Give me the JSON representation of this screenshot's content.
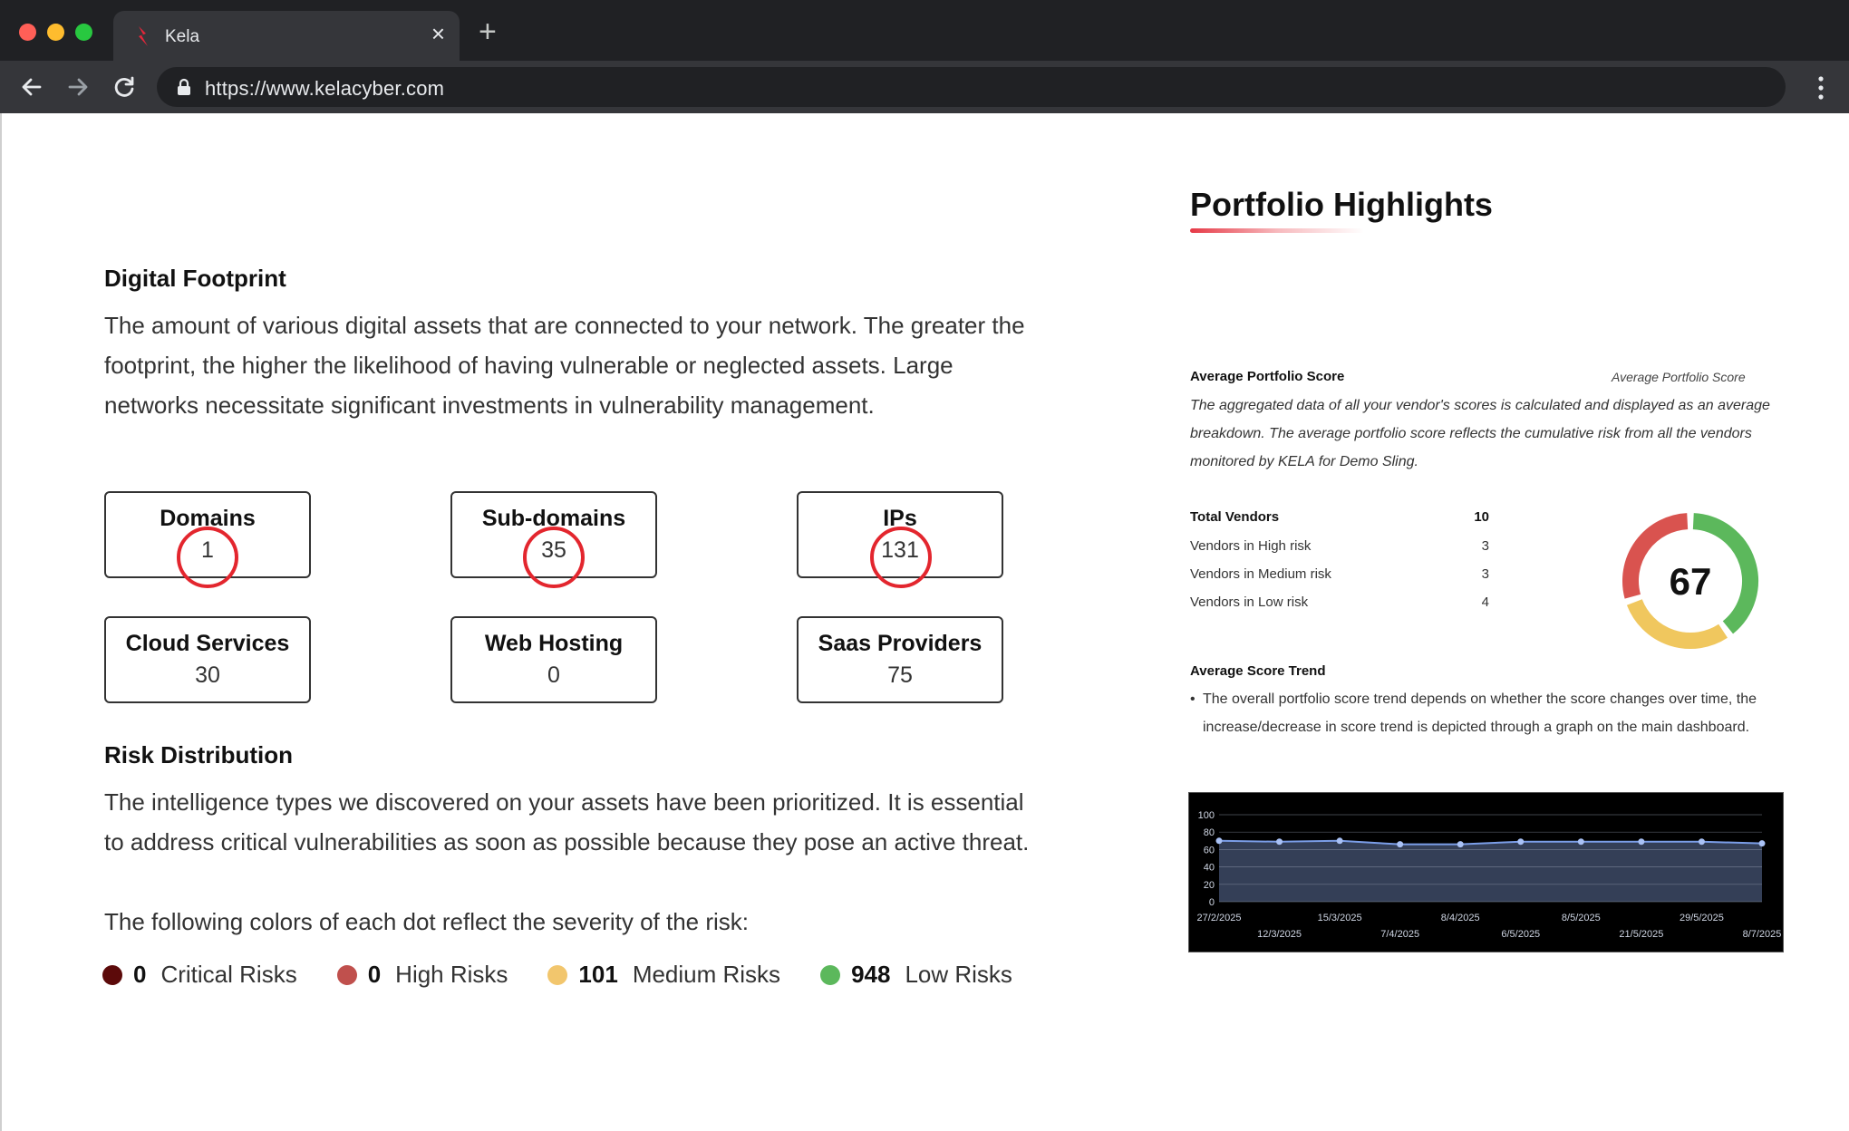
{
  "browser": {
    "tab_title": "Kela",
    "url": "https://www.kelacyber.com",
    "close_glyph": "×",
    "new_tab_glyph": "+"
  },
  "digital_footprint": {
    "heading": "Digital Footprint",
    "description": "The amount of various digital assets that are connected to your network. The greater the footprint, the higher the likelihood of having vulnerable or neglected assets. Large networks necessitate significant investments in vulnerability management.",
    "assets": [
      {
        "label": "Domains",
        "value": "1",
        "circled": true
      },
      {
        "label": "Sub-domains",
        "value": "35",
        "circled": true
      },
      {
        "label": "IPs",
        "value": "131",
        "circled": true
      },
      {
        "label": "Cloud Services",
        "value": "30",
        "circled": false
      },
      {
        "label": "Web Hosting",
        "value": "0",
        "circled": false
      },
      {
        "label": "Saas Providers",
        "value": "75",
        "circled": false
      }
    ]
  },
  "risk_distribution": {
    "heading": "Risk Distribution",
    "description": "The intelligence types we discovered on your assets have been prioritized. It is essential to address critical vulnerabilities as soon as possible because they pose an active threat.",
    "legend_intro": "The following colors of each dot reflect the severity of the risk:",
    "risks": [
      {
        "count": "0",
        "label": "Critical Risks",
        "color": "#5c0a0a"
      },
      {
        "count": "0",
        "label": "High Risks",
        "color": "#c0504d"
      },
      {
        "count": "101",
        "label": "Medium Risks",
        "color": "#f2c66d"
      },
      {
        "count": "948",
        "label": "Low Risks",
        "color": "#5cb85c"
      }
    ]
  },
  "portfolio": {
    "title": "Portfolio Highlights",
    "avg_score_heading": "Average Portfolio Score",
    "avg_score_description": "The aggregated data of all your vendor's scores is calculated and displayed as an average breakdown. The average portfolio score reflects the cumulative risk from all the vendors monitored by KELA for Demo Sling.",
    "donut_caption": "Average Portfolio Score",
    "score": "67",
    "donut_colors": {
      "high": "#d9534f",
      "medium": "#f0c75e",
      "low": "#5cb85c"
    },
    "vendors": [
      {
        "label": "Total Vendors",
        "value": "10",
        "bold": true
      },
      {
        "label": "Vendors in High risk",
        "value": "3",
        "bold": false
      },
      {
        "label": "Vendors in Medium risk",
        "value": "3",
        "bold": false
      },
      {
        "label": "Vendors in Low risk",
        "value": "4",
        "bold": false
      }
    ],
    "trend_heading": "Average Score Trend",
    "trend_bullet": "•",
    "trend_description": "The overall portfolio score trend depends on whether the score changes over time, the increase/decrease in score trend is depicted through a graph on the main dashboard."
  },
  "chart_data": {
    "type": "area",
    "x": [
      "27/2/2025",
      "12/3/2025",
      "15/3/2025",
      "7/4/2025",
      "8/4/2025",
      "6/5/2025",
      "8/5/2025",
      "21/5/2025",
      "29/5/2025",
      "8/7/2025"
    ],
    "values": [
      70,
      69,
      70,
      66,
      66,
      69,
      69,
      69,
      69,
      67
    ],
    "yticks": [
      0,
      20,
      40,
      60,
      80,
      100
    ],
    "ylim": [
      0,
      100
    ],
    "line_color": "#7b9ee8",
    "fill_color": "#3d4a66",
    "grid": true
  }
}
